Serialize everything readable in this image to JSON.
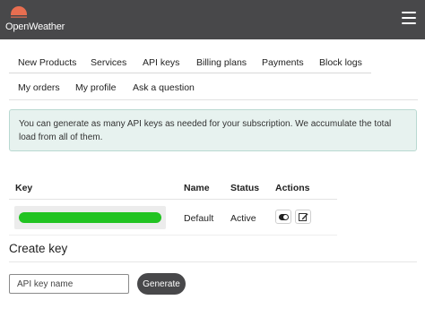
{
  "header": {
    "logo_text": "OpenWeather",
    "brand_color": "#e96e50",
    "bg_color": "#48484a",
    "menu_icon": "hamburger-menu-icon"
  },
  "nav": {
    "tabs": [
      {
        "label": "New Products"
      },
      {
        "label": "Services"
      },
      {
        "label": "API keys",
        "active": true
      },
      {
        "label": "Billing plans"
      },
      {
        "label": "Payments"
      },
      {
        "label": "Block logs"
      },
      {
        "label": "My orders"
      },
      {
        "label": "My profile"
      },
      {
        "label": "Ask a question"
      }
    ]
  },
  "alert": {
    "text": "You can generate as many API keys as needed for your subscription. We accumulate the total load from all of them."
  },
  "table": {
    "headers": {
      "key": "Key",
      "name": "Name",
      "status": "Status",
      "actions": "Actions"
    },
    "rows": [
      {
        "key": "",
        "key_highlight_color": "#21c321",
        "name": "Default",
        "status": "Active",
        "actions": [
          "toggle-icon",
          "edit-icon"
        ]
      }
    ]
  },
  "create": {
    "title": "Create key",
    "input_placeholder": "API key name",
    "button_label": "Generate"
  }
}
